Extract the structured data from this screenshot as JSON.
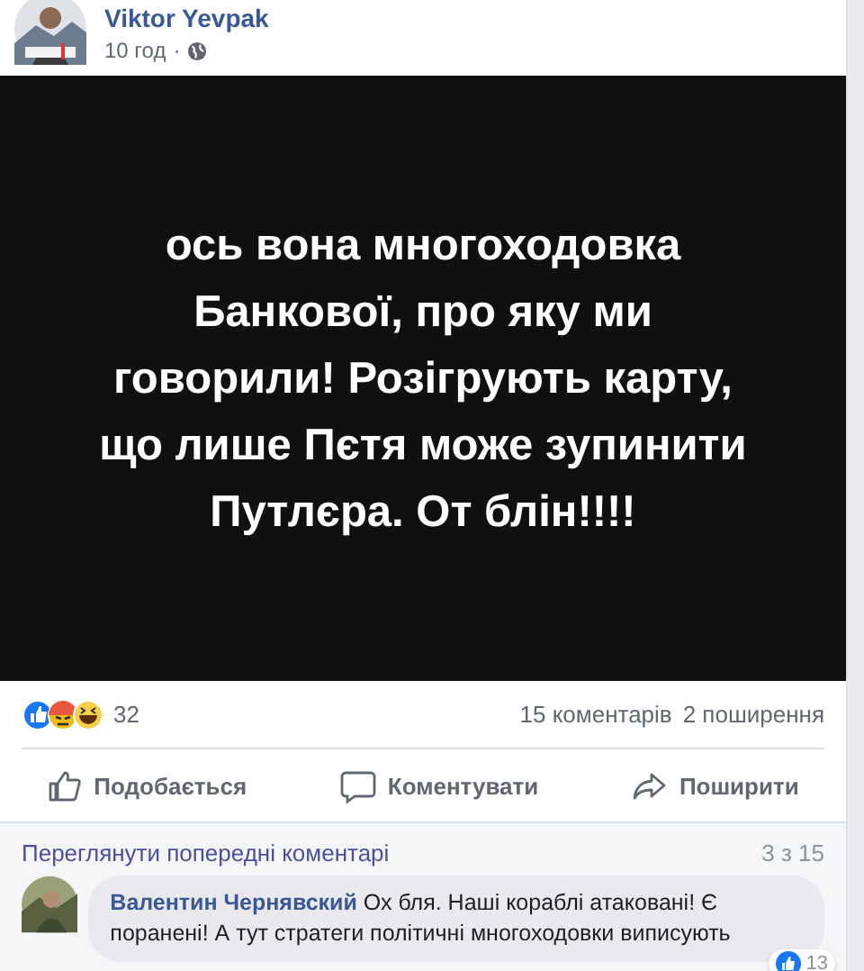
{
  "post": {
    "author": "Viktor Yevpak",
    "time": "10 год",
    "separator": "·",
    "text": "ось вона многоходовка Банкової, про яку ми говорили! Розігрують карту, що лише Пєтя може зупинити Путлєра. От блін!!!!"
  },
  "reactions": {
    "count": "32",
    "comments": "15 коментарів",
    "shares": "2 поширення"
  },
  "actions": [
    {
      "kind": "like",
      "label": "Подобається"
    },
    {
      "kind": "comment",
      "label": "Коментувати"
    },
    {
      "kind": "share",
      "label": "Поширити"
    }
  ],
  "comments_section": {
    "previous_link": "Переглянути попередні коментарі",
    "pager": "3 з 15",
    "comments": [
      {
        "author": "Валентин Чернявский",
        "text": "Ох бля. Наші кораблі атаковані! Є поранені! А тут стратеги політичні многоходовки виписують",
        "likes": "13"
      }
    ]
  }
}
